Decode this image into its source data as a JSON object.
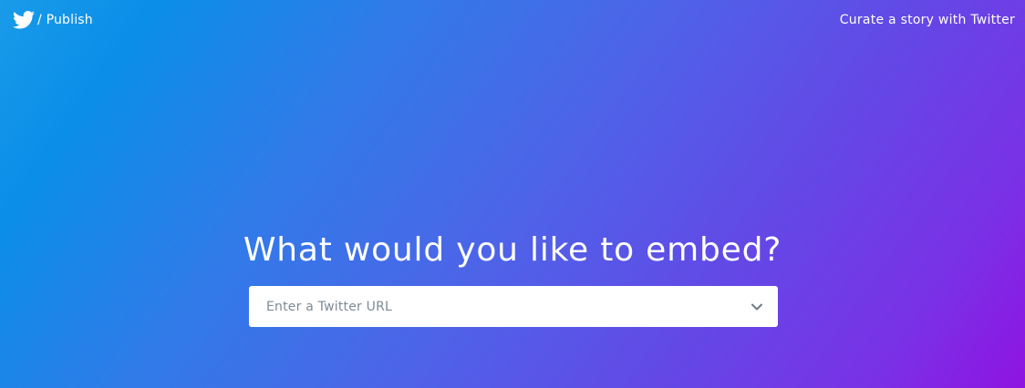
{
  "header": {
    "brand_label": "/ Publish",
    "logo_icon": "twitter-bird-icon",
    "curate_link": "Curate a story with Twitter"
  },
  "main": {
    "headline": "What would you like to embed?",
    "url_input": {
      "value": "",
      "placeholder": "Enter a Twitter URL"
    },
    "dropdown_icon": "chevron-down-icon"
  },
  "colors": {
    "gradient_start": "#1a9be9",
    "gradient_end": "#8f13e1",
    "text": "#ffffff",
    "placeholder": "#7d8a95"
  }
}
